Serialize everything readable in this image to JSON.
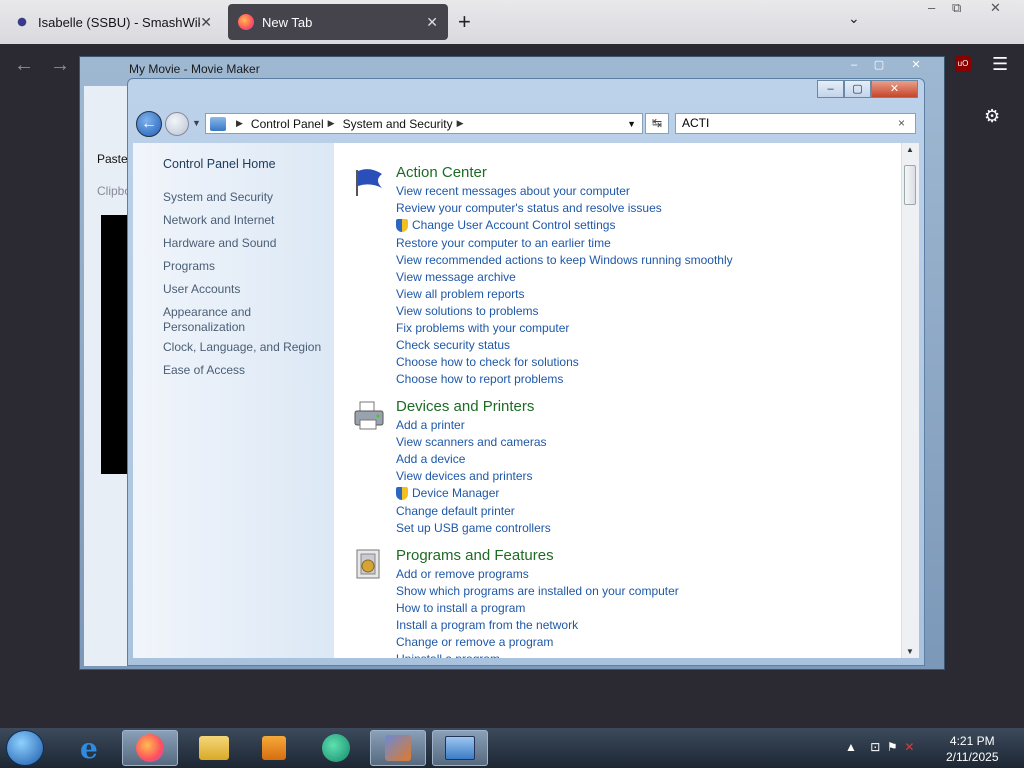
{
  "browser": {
    "tabs": [
      {
        "title": "Isabelle (SSBU) - SmashWiki, th",
        "active": false
      },
      {
        "title": "New Tab",
        "active": true
      }
    ],
    "new_tab_label": "+",
    "tab_list_label": "⌄",
    "window_controls": [
      "–",
      "⧉",
      "✕"
    ],
    "back_label": "←",
    "forward_label": "→",
    "ublock_label": "uO",
    "menu_label": "☰",
    "settings_label": "⚙"
  },
  "movie_maker": {
    "title": "My Movie - Movie Maker",
    "paste_label": "Paste",
    "clipboard_label": "Clipbo",
    "controls": [
      "–",
      "▢",
      "✕"
    ]
  },
  "control_panel": {
    "controls": [
      "–",
      "▢",
      "✕"
    ],
    "breadcrumb": [
      "Control Panel",
      "System and Security"
    ],
    "search_value": "ACTI",
    "search_clear": "×",
    "refresh_label": "↹",
    "left_nav": {
      "home": "Control Panel Home",
      "items": [
        "System and Security",
        "Network and Internet",
        "Hardware and Sound",
        "Programs",
        "User Accounts",
        "Appearance and Personalization",
        "Clock, Language, and Region",
        "Ease of Access"
      ]
    },
    "sections": [
      {
        "title": "Action Center",
        "icon": "flag-icon",
        "links": [
          "View recent messages about your computer",
          "Review your computer's status and resolve issues",
          "Change User Account Control settings",
          "Restore your computer to an earlier time",
          "View recommended actions to keep Windows running smoothly",
          "View message archive",
          "View all problem reports",
          "View solutions to problems",
          "Fix problems with your computer",
          "Check security status",
          "Choose how to check for solutions",
          "Choose how to report problems"
        ]
      },
      {
        "title": "Devices and Printers",
        "icon": "printer-icon",
        "links": [
          "Add a printer",
          "View scanners and cameras",
          "Add a device",
          "View devices and printers",
          "Device Manager",
          "Change default printer",
          "Set up USB game controllers"
        ]
      },
      {
        "title": "Programs and Features",
        "icon": "programs-icon",
        "links": [
          "Add or remove programs",
          "Show which programs are installed on your computer",
          "How to install a program",
          "Install a program from the network",
          "Change or remove a program",
          "Uninstall a program"
        ]
      }
    ]
  },
  "taskbar": {
    "apps": [
      "firefox-icon",
      "ie-icon",
      "firefox-icon",
      "explorer-icon",
      "media-icon",
      "chat-icon",
      "moviemaker-icon",
      "control-panel-icon"
    ],
    "time": "4:21 PM",
    "date": "2/11/2025"
  }
}
